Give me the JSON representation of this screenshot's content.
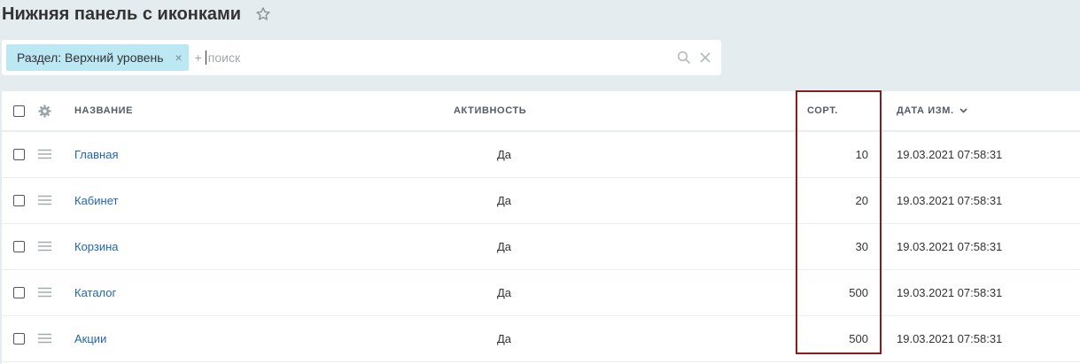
{
  "page": {
    "title": "Нижняя панель с иконками"
  },
  "filter": {
    "tag_label": "Раздел: Верхний уровень",
    "tag_close": "×",
    "add_plus": "+",
    "search_placeholder": "поиск"
  },
  "columns": {
    "name": "НАЗВАНИЕ",
    "active": "АКТИВНОСТЬ",
    "sort": "СОРТ.",
    "date": "ДАТА ИЗМ."
  },
  "rows": [
    {
      "name": "Главная",
      "active": "Да",
      "sort": "10",
      "date": "19.03.2021 07:58:31"
    },
    {
      "name": "Кабинет",
      "active": "Да",
      "sort": "20",
      "date": "19.03.2021 07:58:31"
    },
    {
      "name": "Корзина",
      "active": "Да",
      "sort": "30",
      "date": "19.03.2021 07:58:31"
    },
    {
      "name": "Каталог",
      "active": "Да",
      "sort": "500",
      "date": "19.03.2021 07:58:31"
    },
    {
      "name": "Акции",
      "active": "Да",
      "sort": "500",
      "date": "19.03.2021 07:58:31"
    }
  ],
  "colors": {
    "background": "#e4ecef",
    "tag_bg": "#bce8f4",
    "link": "#2067b0",
    "highlight": "#8b1c1c"
  },
  "icons": [
    "star-icon",
    "search-icon",
    "clear-icon",
    "gear-icon",
    "drag-handle-icon",
    "chevron-down-icon"
  ]
}
